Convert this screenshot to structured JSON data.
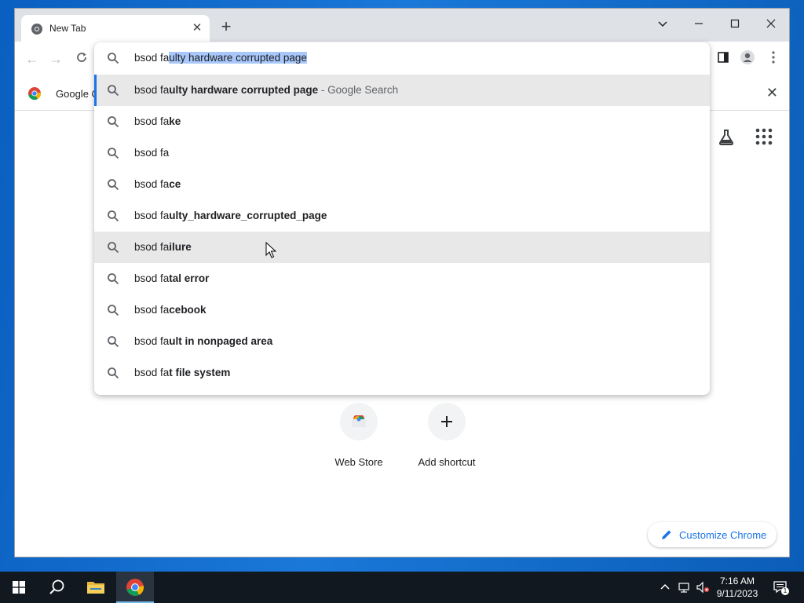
{
  "browser": {
    "tab_title": "New Tab",
    "bookmark_label": "Google C",
    "omnibox": {
      "typed": "bsod fa",
      "autocomplete": "ulty hardware corrupted page"
    },
    "suggestions": [
      {
        "prefix": "bsod fa",
        "bold": "ulty hardware corrupted page",
        "desc": " - Google Search"
      },
      {
        "prefix": "bsod fa",
        "bold": "ke",
        "desc": ""
      },
      {
        "prefix": "bsod fa",
        "bold": "",
        "desc": ""
      },
      {
        "prefix": "bsod fa",
        "bold": "ce",
        "desc": ""
      },
      {
        "prefix": "bsod fa",
        "bold": "ulty_hardware_corrupted_page",
        "desc": ""
      },
      {
        "prefix": "bsod fa",
        "bold": "ilure",
        "desc": ""
      },
      {
        "prefix": "bsod fa",
        "bold": "tal error",
        "desc": ""
      },
      {
        "prefix": "bsod fa",
        "bold": "cebook",
        "desc": ""
      },
      {
        "prefix": "bsod fa",
        "bold": "ult in nonpaged area",
        "desc": ""
      },
      {
        "prefix": "bsod fa",
        "bold": "t file system",
        "desc": ""
      }
    ],
    "shortcuts": [
      {
        "label": "Web Store"
      },
      {
        "label": "Add shortcut"
      }
    ],
    "customize_label": "Customize Chrome"
  },
  "taskbar": {
    "time": "7:16 AM",
    "date": "9/11/2023",
    "notification_count": "1"
  },
  "colors": {
    "accent": "#1a73e8",
    "selection": "#a8c7fa",
    "hover": "#e8e8e9",
    "taskbar": "#111820"
  }
}
